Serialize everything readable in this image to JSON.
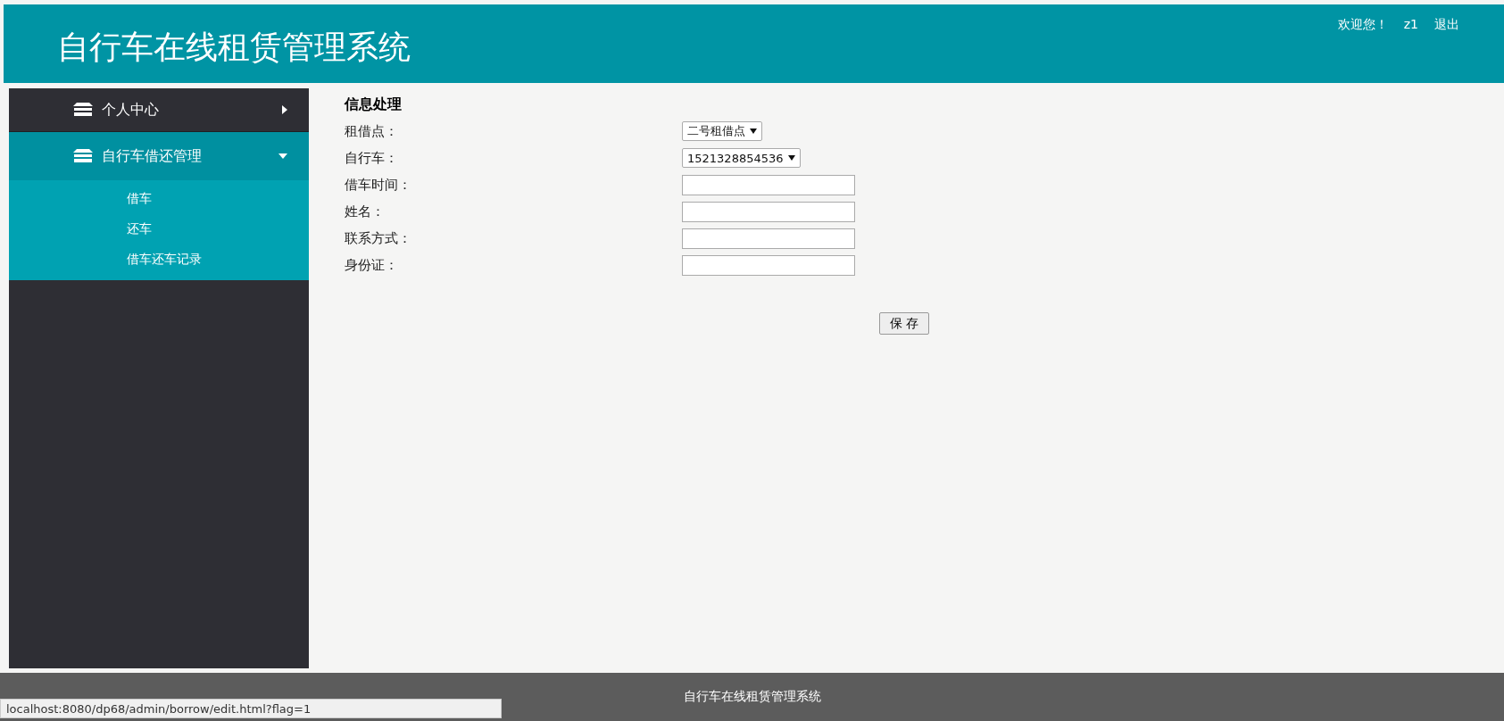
{
  "header": {
    "title": "自行车在线租赁管理系统",
    "welcome": "欢迎您！",
    "user": "z1",
    "logout": "退出"
  },
  "sidebar": {
    "items": [
      {
        "label": "个人中心",
        "expanded": false
      },
      {
        "label": "自行车借还管理",
        "expanded": true,
        "children": [
          {
            "label": "借车"
          },
          {
            "label": "还车"
          },
          {
            "label": "借车还车记录"
          }
        ]
      }
    ]
  },
  "form": {
    "title": "信息处理",
    "fields": [
      {
        "kind": "select",
        "label": "租借点：",
        "value": "二号租借点"
      },
      {
        "kind": "select",
        "label": "自行车：",
        "value": "1521328854536"
      },
      {
        "kind": "text",
        "label": "借车时间："
      },
      {
        "kind": "text",
        "label": "姓名："
      },
      {
        "kind": "text",
        "label": "联系方式："
      },
      {
        "kind": "text",
        "label": "身份证："
      }
    ],
    "save_button": "保 存"
  },
  "footer": {
    "text": "自行车在线租赁管理系统"
  },
  "status_bar": {
    "url": "localhost:8080/dp68/admin/borrow/edit.html?flag=1"
  }
}
